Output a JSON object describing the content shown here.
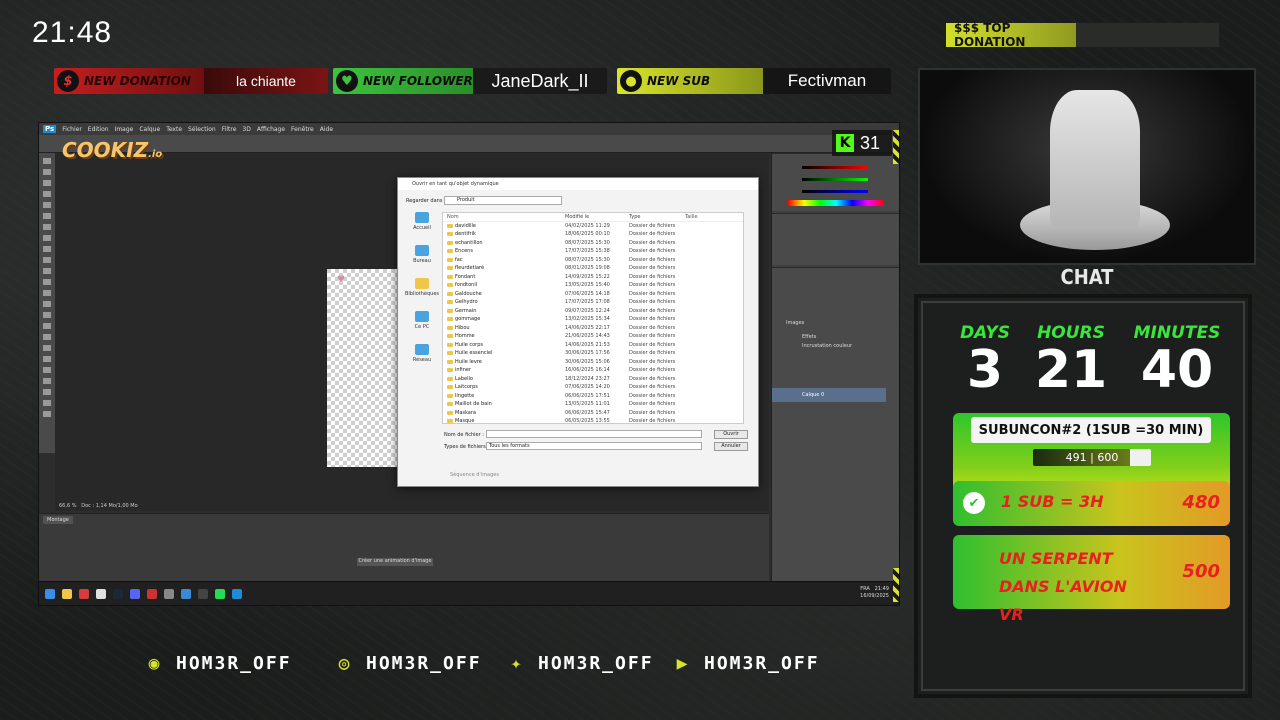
{
  "clock": "21:48",
  "alerts": {
    "donation": {
      "label": "NEW DONATION",
      "value": "la chiante",
      "icon": "dollar-icon"
    },
    "follower": {
      "label": "NEW FOLLOWER",
      "value": "JaneDark_II",
      "icon": "heart-icon"
    },
    "sub": {
      "label": "NEW SUB",
      "value": "Fectivman",
      "icon": "users-icon"
    }
  },
  "top_donation": {
    "label": "$$$ TOP DONATION",
    "value": ""
  },
  "chat": {
    "title": "CHAT"
  },
  "subathon": {
    "days_label": "DAYS",
    "days": "3",
    "hours_label": "HOURS",
    "hours": "21",
    "minutes_label": "MINUTES",
    "minutes": "40",
    "goal_title": "SUBUNCON#2 (1SUB =30 MIN)",
    "goal_progress_text": "491 | 600",
    "goal_current": 491,
    "goal_target": 600,
    "milestones": [
      {
        "name": "1 SUB = 3H",
        "cost": "480",
        "done": true
      },
      {
        "name": "UN SERPENT DANS L'AVION VR",
        "cost": "500",
        "done": false
      }
    ]
  },
  "socials": [
    {
      "icon": "discord-icon",
      "handle": "HOM3R_OFF"
    },
    {
      "icon": "instagram-icon",
      "handle": "HOM3R_OFF"
    },
    {
      "icon": "twitter-icon",
      "handle": "HOM3R_OFF"
    },
    {
      "icon": "youtube-icon",
      "handle": "HOM3R_OFF"
    }
  ],
  "overlay": {
    "sponsor": "COOKIZ",
    "sponsor_suffix": ".io",
    "kick_viewers": "31"
  },
  "photoshop": {
    "menu": [
      "Fichier",
      "Edition",
      "Image",
      "Calque",
      "Texte",
      "Sélection",
      "Filtre",
      "3D",
      "Affichage",
      "Fenêtre",
      "Aide"
    ],
    "zoom": "66,6 %",
    "doc_info": "Doc : 1,14 Mo/1,00 Mo",
    "timeline_tab": "Montage",
    "create_anim_button": "Créer une animation d'image",
    "layers": [
      "Images",
      "Effets",
      "Incrustation couleur",
      "Calque 0"
    ]
  },
  "dialog": {
    "title": "Ouvrir en tant qu'objet dynamique",
    "look_in_label": "Regarder dans :",
    "look_in_value": "Produit",
    "places": [
      "Accueil",
      "Bureau",
      "Bibliothèques",
      "Ce PC",
      "Réseau"
    ],
    "columns": [
      "Nom",
      "Modifié le",
      "Type",
      "Taille"
    ],
    "files": [
      {
        "name": "davidille",
        "date": "04/02/2025 11:29",
        "type": "Dossier de fichiers"
      },
      {
        "name": "dentifrik",
        "date": "18/06/2025 00:10",
        "type": "Dossier de fichiers"
      },
      {
        "name": "echantillon",
        "date": "08/07/2025 15:30",
        "type": "Dossier de fichiers"
      },
      {
        "name": "Encens",
        "date": "17/07/2025 15:38",
        "type": "Dossier de fichiers"
      },
      {
        "name": "fac",
        "date": "08/07/2025 15:30",
        "type": "Dossier de fichiers"
      },
      {
        "name": "fleurdetiaré",
        "date": "08/01/2025 19:08",
        "type": "Dossier de fichiers"
      },
      {
        "name": "Fondant",
        "date": "14/09/2025 15:22",
        "type": "Dossier de fichiers"
      },
      {
        "name": "fondtonil",
        "date": "13/05/2025 15:40",
        "type": "Dossier de fichiers"
      },
      {
        "name": "Galdouche",
        "date": "07/06/2025 14:18",
        "type": "Dossier de fichiers"
      },
      {
        "name": "Gelhydro",
        "date": "17/07/2025 17:08",
        "type": "Dossier de fichiers"
      },
      {
        "name": "Germain",
        "date": "09/07/2025 12:24",
        "type": "Dossier de fichiers"
      },
      {
        "name": "gommage",
        "date": "13/02/2025 15:34",
        "type": "Dossier de fichiers"
      },
      {
        "name": "Hibou",
        "date": "14/06/2025 22:17",
        "type": "Dossier de fichiers"
      },
      {
        "name": "Homme",
        "date": "21/06/2025 14:43",
        "type": "Dossier de fichiers"
      },
      {
        "name": "Huile corps",
        "date": "14/06/2025 21:53",
        "type": "Dossier de fichiers"
      },
      {
        "name": "Huile essenciel",
        "date": "30/06/2025 17:56",
        "type": "Dossier de fichiers"
      },
      {
        "name": "Huile levre",
        "date": "30/06/2025 15:06",
        "type": "Dossier de fichiers"
      },
      {
        "name": "infiner",
        "date": "16/06/2025 16:14",
        "type": "Dossier de fichiers"
      },
      {
        "name": "Labello",
        "date": "18/12/2024 23:27",
        "type": "Dossier de fichiers"
      },
      {
        "name": "Laitcorps",
        "date": "07/06/2025 14:20",
        "type": "Dossier de fichiers"
      },
      {
        "name": "lingette",
        "date": "06/06/2025 17:51",
        "type": "Dossier de fichiers"
      },
      {
        "name": "Maillot de bain",
        "date": "13/05/2025 11:01",
        "type": "Dossier de fichiers"
      },
      {
        "name": "Maskara",
        "date": "06/06/2025 15:47",
        "type": "Dossier de fichiers"
      },
      {
        "name": "Masque",
        "date": "06/05/2025 13:55",
        "type": "Dossier de fichiers"
      }
    ],
    "file_name_label": "Nom de fichier :",
    "file_type_label": "Types de fichiers :",
    "file_type_value": "Tous les formats",
    "open_button": "Ouvrir",
    "cancel_button": "Annuler",
    "sequence_label": "Séquence d'images"
  },
  "taskbar": {
    "lang": "FRA",
    "time": "21:49",
    "date": "16/09/2025"
  }
}
